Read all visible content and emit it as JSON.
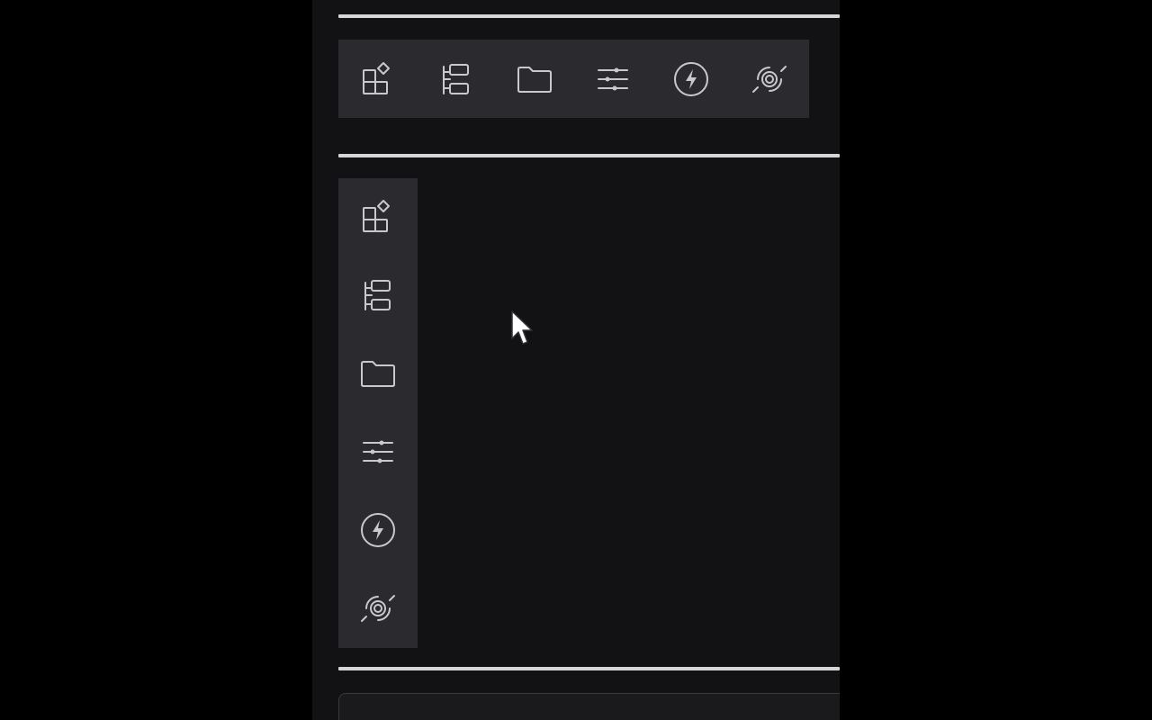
{
  "toolbars": {
    "horizontal": {
      "items": [
        {
          "icon": "widgets-edit-icon"
        },
        {
          "icon": "tree-structure-icon"
        },
        {
          "icon": "folder-icon"
        },
        {
          "icon": "sliders-icon"
        },
        {
          "icon": "lightning-circle-icon"
        },
        {
          "icon": "broadcast-off-icon"
        }
      ]
    },
    "vertical": {
      "items": [
        {
          "icon": "widgets-edit-icon"
        },
        {
          "icon": "tree-structure-icon"
        },
        {
          "icon": "folder-icon"
        },
        {
          "icon": "sliders-icon"
        },
        {
          "icon": "lightning-circle-icon"
        },
        {
          "icon": "broadcast-off-icon"
        }
      ]
    }
  },
  "colors": {
    "page_background": "#000000",
    "canvas_background": "#121214",
    "toolbar_background": "#2b2b2f",
    "icon_color": "#c9c9cc",
    "divider_color": "#d6d6d8"
  }
}
